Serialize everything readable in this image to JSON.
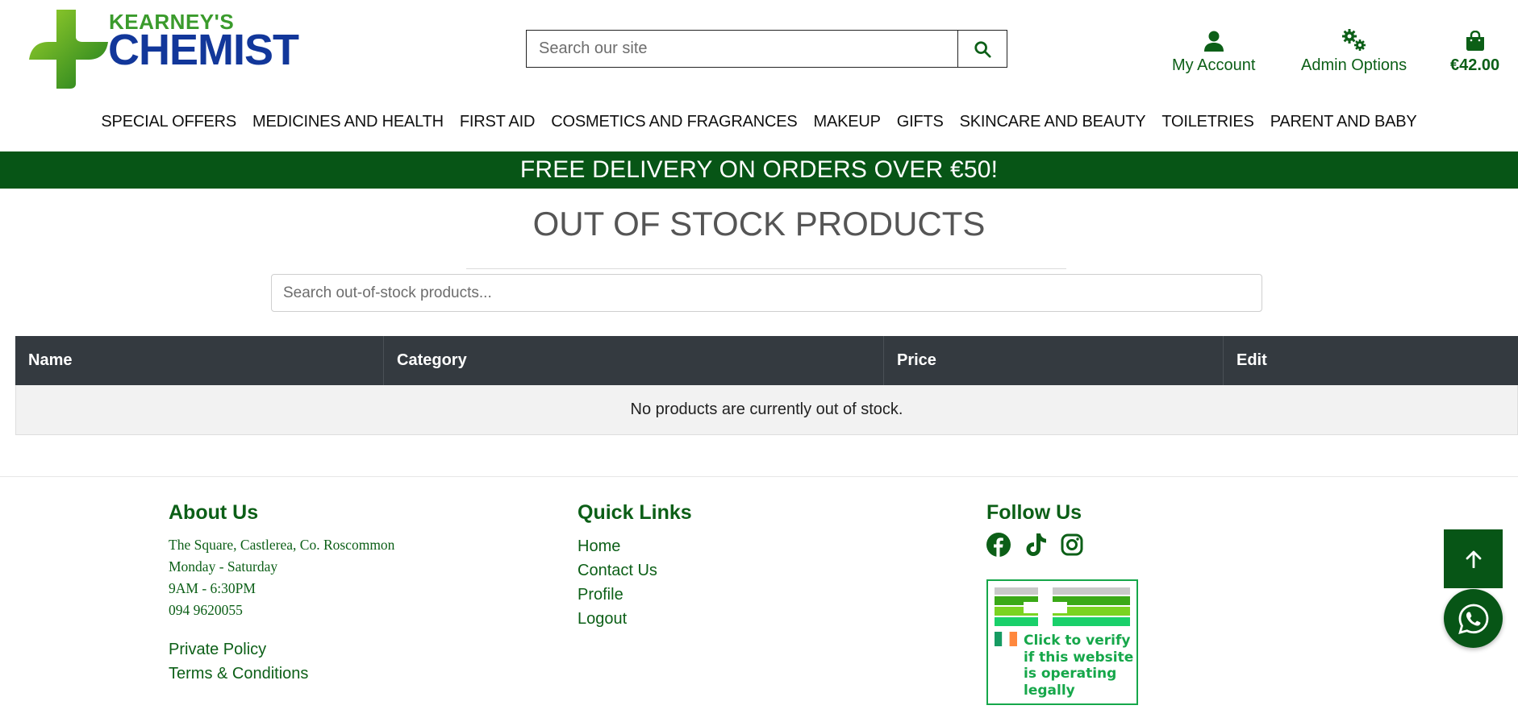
{
  "brand": {
    "logo_top": "KEARNEY'S",
    "logo_bottom": "CHEMIST",
    "colors": {
      "green": "#3a9b2c",
      "blue": "#12379a",
      "dark_green": "#075516"
    }
  },
  "header": {
    "search_placeholder": "Search our site",
    "search_icon": "search-icon",
    "my_account_label": "My Account",
    "admin_options_label": "Admin Options",
    "bag_total": "€42.00"
  },
  "nav": {
    "items": [
      {
        "label": "SPECIAL OFFERS"
      },
      {
        "label": "MEDICINES AND HEALTH"
      },
      {
        "label": "FIRST AID"
      },
      {
        "label": "COSMETICS AND FRAGRANCES"
      },
      {
        "label": "MAKEUP"
      },
      {
        "label": "GIFTS"
      },
      {
        "label": "SKINCARE AND BEAUTY"
      },
      {
        "label": "TOILETRIES"
      },
      {
        "label": "PARENT AND BABY"
      }
    ]
  },
  "banner": {
    "text": "FREE DELIVERY ON ORDERS OVER €50!"
  },
  "main": {
    "title": "OUT OF STOCK PRODUCTS",
    "search_placeholder": "Search out-of-stock products...",
    "table": {
      "headers": [
        "Name",
        "Category",
        "Price",
        "Edit"
      ],
      "empty_message": "No products are currently out of stock."
    }
  },
  "footer": {
    "about": {
      "heading": "About Us",
      "address": "The Square, Castlerea, Co. Roscommon",
      "days": "Monday - Saturday",
      "hours": "9AM - 6:30PM",
      "phone": "094 9620055",
      "privacy_link": "Private Policy",
      "terms_link": "Terms & Conditions"
    },
    "quick_links": {
      "heading": "Quick Links",
      "items": [
        "Home",
        "Contact Us",
        "Profile",
        "Logout"
      ]
    },
    "follow": {
      "heading": "Follow Us",
      "icons": [
        "facebook-icon",
        "tiktok-icon",
        "instagram-icon"
      ],
      "verify_lines": [
        "Click to verify",
        "if this website",
        "is operating",
        "legally"
      ]
    }
  }
}
